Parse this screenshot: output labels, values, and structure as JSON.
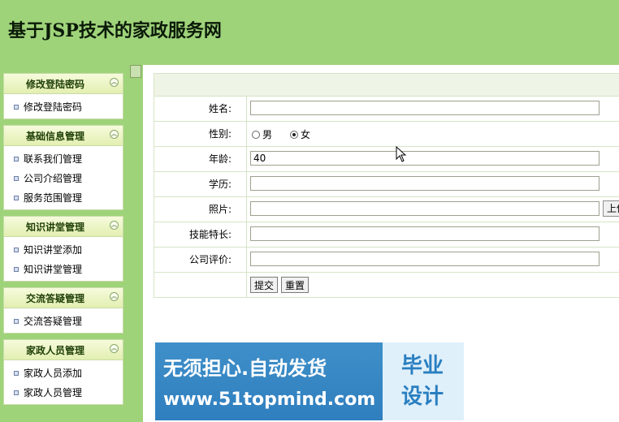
{
  "header": {
    "title": "基于JSP技术的家政服务网"
  },
  "sidebar": {
    "groups": [
      {
        "title": "修改登陆密码",
        "items": [
          "修改登陆密码"
        ]
      },
      {
        "title": "基础信息管理",
        "items": [
          "联系我们管理",
          "公司介绍管理",
          "服务范围管理"
        ]
      },
      {
        "title": "知识讲堂管理",
        "items": [
          "知识讲堂添加",
          "知识讲堂管理"
        ]
      },
      {
        "title": "交流答疑管理",
        "items": [
          "交流答疑管理"
        ]
      },
      {
        "title": "家政人员管理",
        "items": [
          "家政人员添加",
          "家政人员管理"
        ]
      }
    ]
  },
  "form": {
    "name_label": "姓名:",
    "name_value": "",
    "gender_label": "性别:",
    "gender_options": [
      "男",
      "女"
    ],
    "gender_selected": "女",
    "age_label": "年龄:",
    "age_value": "40",
    "education_label": "学历:",
    "education_value": "",
    "photo_label": "照片:",
    "photo_value": "",
    "upload_label": "上传",
    "skills_label": "技能特长:",
    "skills_value": "",
    "rating_label": "公司评价:",
    "rating_value": "",
    "submit_label": "提交",
    "reset_label": "重置"
  },
  "banner": {
    "main_text": "无须担心.自动发货",
    "url_text": "www.51topmind.com",
    "side_text": "毕业设计"
  }
}
